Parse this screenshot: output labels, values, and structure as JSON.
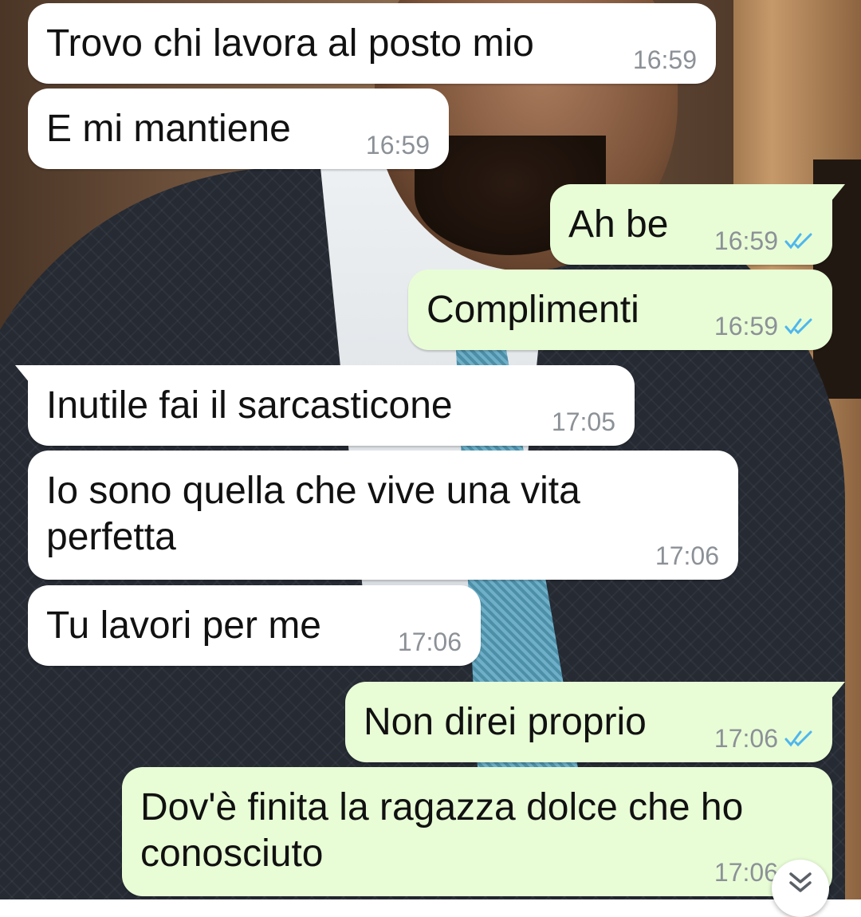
{
  "messages": [
    {
      "direction": "incoming",
      "text": "Trovo chi lavora al posto mio",
      "time": "16:59"
    },
    {
      "direction": "incoming",
      "text": "E mi mantiene",
      "time": "16:59"
    },
    {
      "direction": "outgoing",
      "text": "Ah be",
      "time": "16:59",
      "status": "read"
    },
    {
      "direction": "outgoing",
      "text": "Complimenti",
      "time": "16:59",
      "status": "read"
    },
    {
      "direction": "incoming",
      "text": "Inutile fai il sarcasticone",
      "time": "17:05"
    },
    {
      "direction": "incoming",
      "text": "Io sono quella che vive una vita\nperfetta",
      "time": "17:06"
    },
    {
      "direction": "incoming",
      "text": "Tu lavori per me",
      "time": "17:06"
    },
    {
      "direction": "outgoing",
      "text": "Non direi proprio",
      "time": "17:06",
      "status": "read"
    },
    {
      "direction": "outgoing",
      "text": "Dov'è finita la ragazza dolce che ho\nconosciuto",
      "time": "17:06",
      "status": "read"
    }
  ],
  "scroll_button": {
    "icon": "double-chevron-down-icon"
  },
  "colors": {
    "incoming_bubble": "#ffffff",
    "outgoing_bubble": "#e8fdd6",
    "read_ticks": "#4fb6ec",
    "timestamp": "#8c9197"
  }
}
